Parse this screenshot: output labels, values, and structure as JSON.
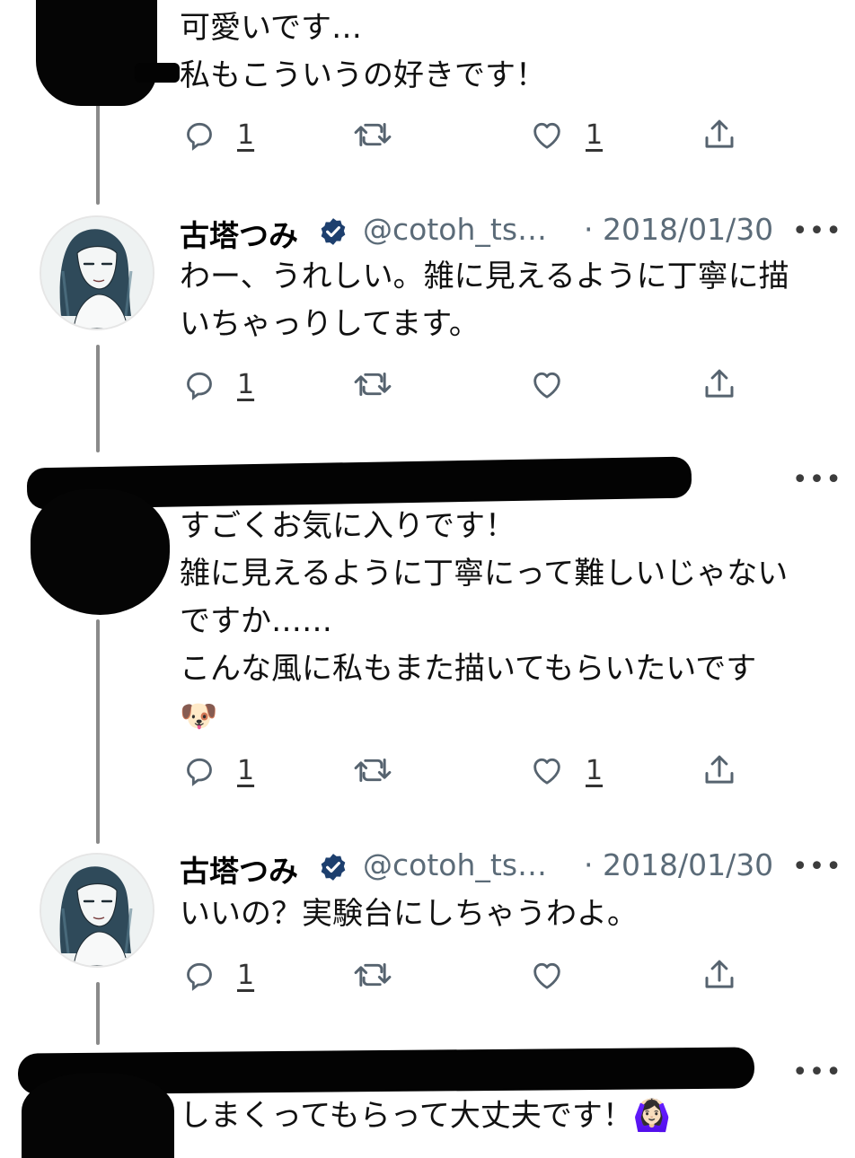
{
  "tweets": [
    {
      "author_redacted": true,
      "lines": [
        "可愛いです…",
        "私もこういうの好きです！"
      ],
      "replies": "1",
      "likes": "1"
    },
    {
      "author_name": "古塔つみ",
      "handle": "@cotoh_ts…",
      "date": "· 2018/01/30",
      "lines": [
        "わー、うれしい。雑に見えるように丁寧に描",
        "いちゃっりしてます。"
      ],
      "replies": "1",
      "likes": ""
    },
    {
      "author_redacted": true,
      "lines": [
        "すごくお気に入りです！",
        "雑に見えるように丁寧にって難しいじゃない",
        "ですか……",
        "こんな風に私もまた描いてもらいたいです",
        "🐶"
      ],
      "replies": "1",
      "likes": "1"
    },
    {
      "author_name": "古塔つみ",
      "handle": "@cotoh_ts…",
      "date": "· 2018/01/30",
      "lines": [
        "いいの？実験台にしちゃうわよ。"
      ],
      "replies": "1",
      "likes": ""
    },
    {
      "author_redacted": true,
      "lines": [
        "しまくってもらって大丈夫です！🙆🏻‍♀️"
      ]
    }
  ],
  "more_glyph": "•••",
  "icons": {
    "reply": "reply-icon",
    "retweet": "retweet-icon",
    "like": "heart-icon",
    "share": "share-icon",
    "verified": "verified-badge-icon"
  },
  "colors": {
    "verified": "#1d3f6e",
    "icon": "#56636f",
    "thread": "#8a8a8a"
  }
}
